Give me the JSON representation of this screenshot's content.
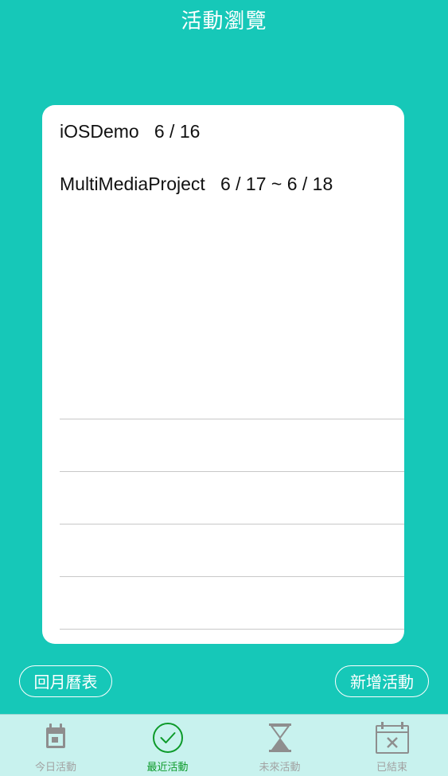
{
  "header": {
    "title": "活動瀏覽"
  },
  "activities": [
    {
      "text": "iOSDemo   6 / 16"
    },
    {
      "text": "MultiMediaProject   6 / 17 ~ 6 / 18"
    }
  ],
  "buttons": {
    "back_label": "回月曆表",
    "add_label": "新增活動"
  },
  "tabs": [
    {
      "label": "今日活動",
      "icon": "calendar-day-icon",
      "active": false
    },
    {
      "label": "最近活動",
      "icon": "check-circle-icon",
      "active": true
    },
    {
      "label": "未來活動",
      "icon": "hourglass-icon",
      "active": false
    },
    {
      "label": "已結束",
      "icon": "calendar-x-icon",
      "active": false
    }
  ],
  "colors": {
    "background": "#16c8b8",
    "card": "#ffffff",
    "tabbar": "#c8f2ee",
    "active_tab": "#0d9a2a",
    "inactive_tab": "#a2a2a2"
  }
}
